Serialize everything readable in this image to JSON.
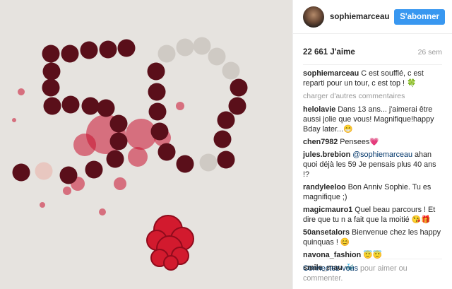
{
  "post": {
    "image_alt": "Photo",
    "username": "sophiemarceau",
    "follow_label": "S'abonner",
    "likes": "22 661 J'aime",
    "age": "26 sem"
  },
  "caption": {
    "author": "sophiemarceau",
    "text": "C est soufflé, c est reparti pour un tour, c est top ! 🍀"
  },
  "more_comments_label": "charger d'autres commentaires",
  "comments": [
    {
      "author": "helolavie",
      "text": "Dans 13 ans... j'aimerai être aussi jolie que vous! Magnifique!happy Bday later...😁"
    },
    {
      "author": "chen7982",
      "text": "Pensees💗"
    },
    {
      "author": "jules.brebion",
      "mention": "@sophiemarceau",
      "text": "ahan quoi déjà les 59 Je pensais plus 40 ans !?"
    },
    {
      "author": "randyleeloo",
      "text": "Bon Anniv Sophie. Tu es magnifique ;)"
    },
    {
      "author": "magicmauro1",
      "text": "Quel beau parcours ! Et dire que tu n a fait que la moitié 😘🎁"
    },
    {
      "author": "50ansetalors",
      "text": "Bienvenue chez les happy quinquas ! 😊"
    },
    {
      "author": "navona_fashion",
      "text": "😇😇"
    },
    {
      "author": "smile_mau",
      "text": "🐳"
    }
  ],
  "footer": {
    "login_label": "Connectez-vous",
    "rest": "pour aimer ou commenter."
  },
  "colors": {
    "accent": "#3897f0",
    "link": "#003569",
    "muted": "#999999",
    "candle_red": "#5a0f1a",
    "candle_white": "#cfcac4",
    "wax": "#c8102e"
  }
}
